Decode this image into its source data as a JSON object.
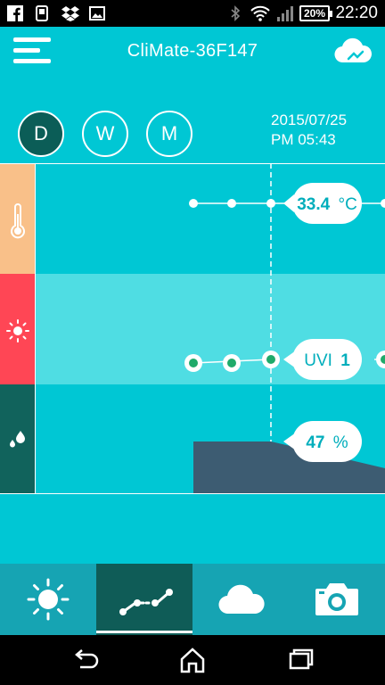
{
  "status_bar": {
    "battery": "20%",
    "time": "22:20",
    "icons": [
      "facebook-icon",
      "phone-icon",
      "dropbox-icon",
      "image-icon",
      "bluetooth-icon",
      "wifi-icon",
      "signal-icon",
      "battery-icon"
    ]
  },
  "header": {
    "title": "CliMate-36F147",
    "menu_icon": "hamburger-menu-icon",
    "cloud_icon": "cloud-sync-icon"
  },
  "period_selector": [
    {
      "label": "D",
      "active": true
    },
    {
      "label": "W",
      "active": false
    },
    {
      "label": "M",
      "active": false
    }
  ],
  "datetime": {
    "date": "2015/07/25",
    "time": "PM 05:43"
  },
  "rows": [
    {
      "name": "temperature",
      "icon": "thermometer-icon",
      "color": "#f9c089",
      "reading": "33.4",
      "unit": "°C"
    },
    {
      "name": "uv",
      "icon": "sun-icon",
      "color": "#ff4655",
      "reading_prefix": "UVI",
      "reading": "1"
    },
    {
      "name": "humidity",
      "icon": "water-drops-icon",
      "color": "#11635c",
      "reading": "47",
      "unit": "%"
    }
  ],
  "chart_data": {
    "type": "line",
    "series": [
      {
        "values": [
          33.4,
          33.4,
          33.4,
          33.4
        ]
      },
      {
        "values": [
          1,
          1,
          1,
          1
        ]
      },
      {
        "values": [
          47,
          47,
          47
        ]
      }
    ]
  },
  "bottom_nav": [
    {
      "icon": "sun-icon",
      "active": false
    },
    {
      "icon": "chart-line-icon",
      "active": true
    },
    {
      "icon": "cloud-icon",
      "active": false
    },
    {
      "icon": "camera-icon",
      "active": false
    }
  ],
  "system_nav": [
    "back-icon",
    "home-icon",
    "recents-icon"
  ],
  "colors": {
    "background": "#00c7d4",
    "row_uv_bg": "#4fdde3",
    "dark_teal": "#0f5c57",
    "humidity_fill": "#3d5c72",
    "marker_green": "#1faa6a"
  }
}
